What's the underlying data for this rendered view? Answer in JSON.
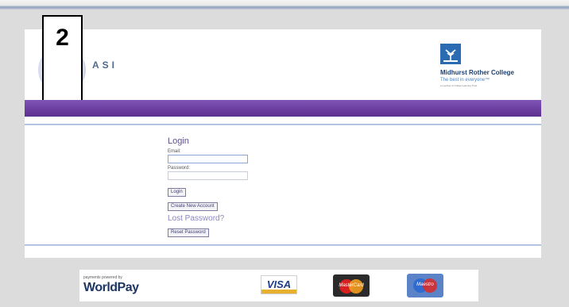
{
  "header": {
    "step_number": "2",
    "logo_text": "ASI",
    "college_name": "Midhurst Rother College",
    "college_tagline": "The best in everyone™",
    "college_subtext": "a member of United Learning Trust"
  },
  "login": {
    "title": "Login",
    "email_label": "Email:",
    "email_value": "",
    "password_label": "Password:",
    "password_value": "",
    "login_button": "Login",
    "create_account_button": "Create New Account",
    "lost_password_text": "Lost Password?",
    "reset_password_button": "Reset Password"
  },
  "footer": {
    "payments_text": "payments powered by",
    "worldpay_text": "WorldPay",
    "visa_text": "VISA",
    "mastercard_text": "MasterCard",
    "maestro_text": "Maestro"
  },
  "colors": {
    "purple_bar": "#5d2f8f",
    "login_title": "#5f5087",
    "link_purple": "#8b86c3"
  },
  "icons": {
    "college_logo": "tree-logo-icon",
    "visa": "visa-card-icon",
    "mastercard": "mastercard-icon",
    "maestro": "maestro-icon"
  }
}
